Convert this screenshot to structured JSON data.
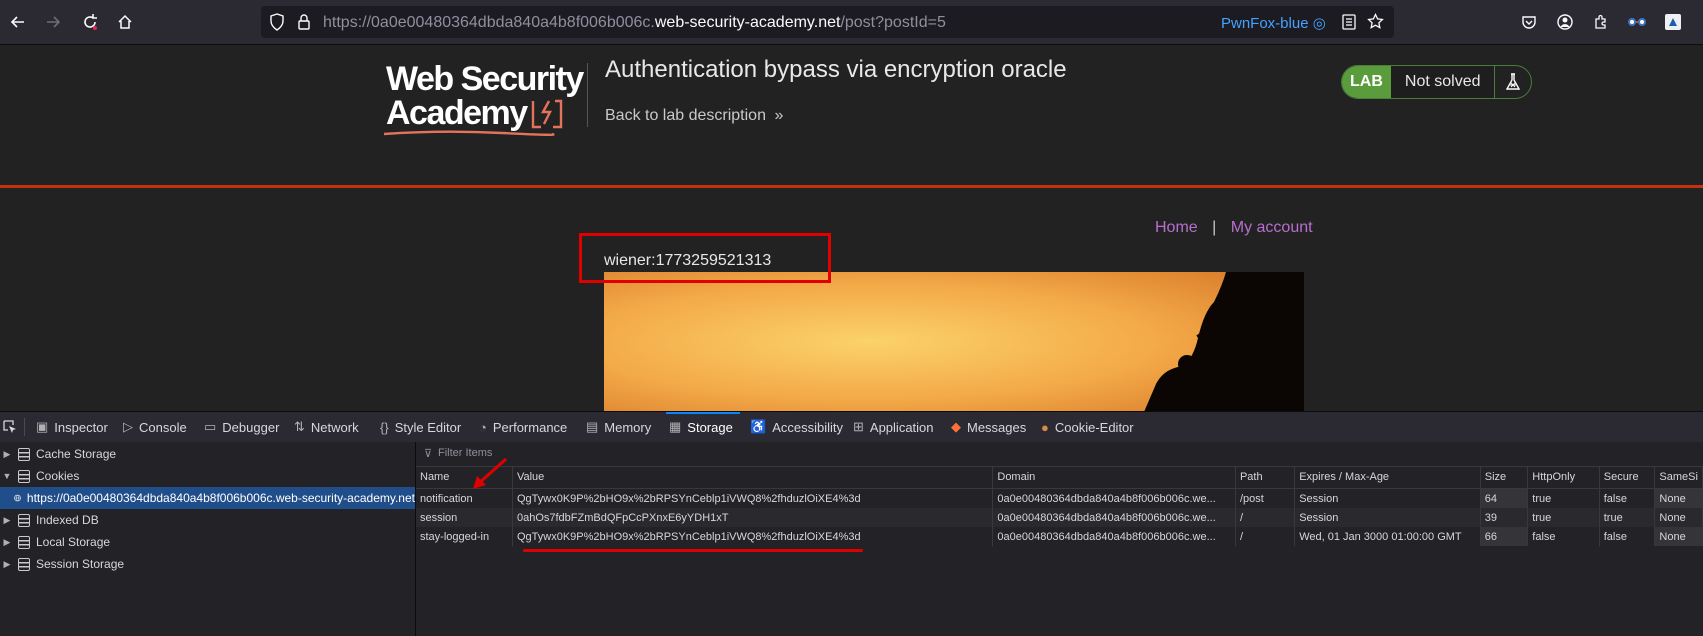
{
  "browser": {
    "url_prefix": "https://0a0e00480364dbda840a4b8f006b006c.",
    "url_domain": "web-security-academy.net",
    "url_suffix": "/post?postId=5",
    "container": "PwnFox-blue"
  },
  "site": {
    "logo_line1": "Web Security",
    "logo_line2": "Academy",
    "lab_title": "Authentication bypass via encryption oracle",
    "back_link": "Back to lab description",
    "lab_label": "LAB",
    "lab_status": "Not solved",
    "nav_home": "Home",
    "nav_sep": "|",
    "nav_account": "My account",
    "user_text": "wiener:1773259521313"
  },
  "devtools": {
    "tabs": [
      "Inspector",
      "Console",
      "Debugger",
      "Network",
      "Style Editor",
      "Performance",
      "Memory",
      "Storage",
      "Accessibility",
      "Application",
      "Messages",
      "Cookie-Editor"
    ],
    "active_tab": "Storage",
    "sidebar": {
      "cache": "Cache Storage",
      "cookies": "Cookies",
      "cookie_host": "https://0a0e00480364dbda840a4b8f006b006c.web-security-academy.net",
      "indexed": "Indexed DB",
      "local": "Local Storage",
      "session": "Session Storage"
    },
    "filter_placeholder": "Filter Items",
    "columns": [
      "Name",
      "Value",
      "Domain",
      "Path",
      "Expires / Max-Age",
      "Size",
      "HttpOnly",
      "Secure",
      "SameSi"
    ],
    "rows": [
      [
        "notification",
        "QgTywx0K9P%2bHO9x%2bRPSYnCeblp1iVWQ8%2fhduzlOiXE4%3d",
        "0a0e00480364dbda840a4b8f006b006c.we...",
        "/post",
        "Session",
        "64",
        "true",
        "false",
        "None"
      ],
      [
        "session",
        "0ahOs7fdbFZmBdQFpCcPXnxE6yYDH1xT",
        "0a0e00480364dbda840a4b8f006b006c.we...",
        "/",
        "Session",
        "39",
        "true",
        "true",
        "None"
      ],
      [
        "stay-logged-in",
        "QgTywx0K9P%2bHO9x%2bRPSYnCeblp1iVWQ8%2fhduzlOiXE4%3d",
        "0a0e00480364dbda840a4b8f006b006c.we...",
        "/",
        "Wed, 01 Jan 3000 01:00:00 GMT",
        "66",
        "false",
        "false",
        "None"
      ]
    ]
  },
  "colors": {
    "accent_red": "#e00000",
    "link_purple": "#b86ece",
    "header_rule": "#c2320e",
    "lab_green": "#5a9c3c"
  }
}
